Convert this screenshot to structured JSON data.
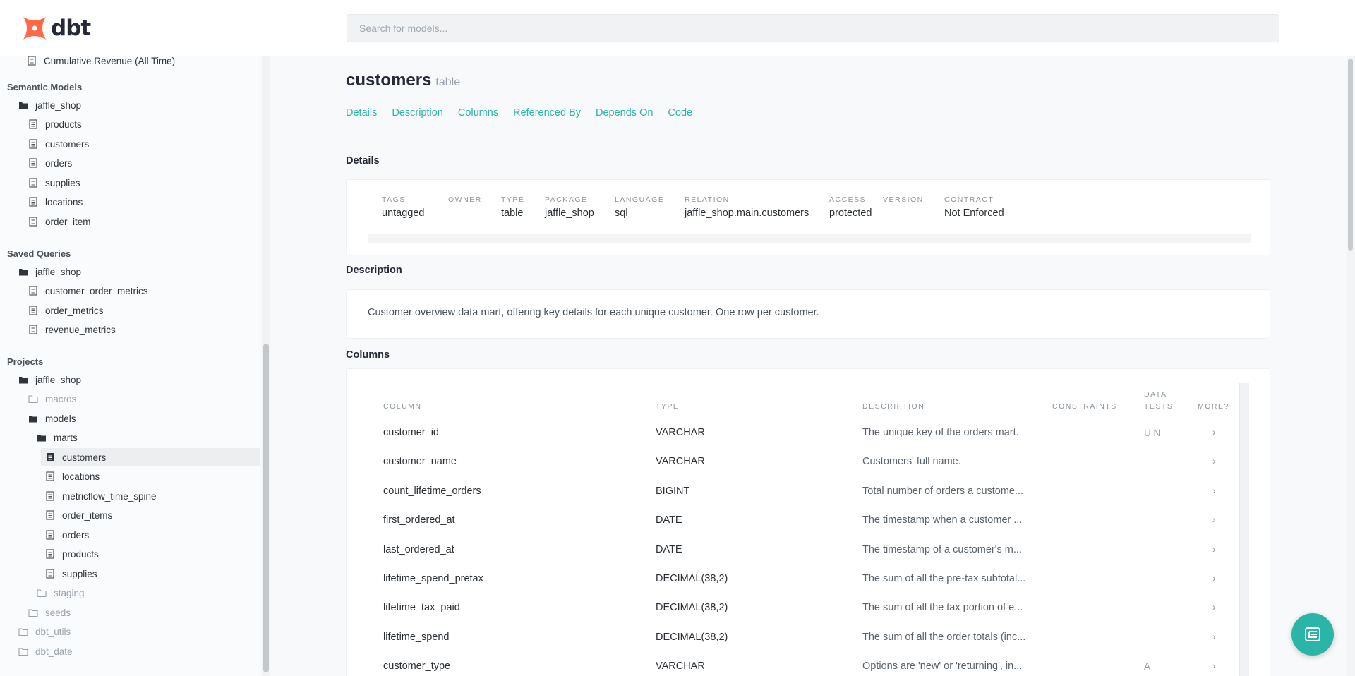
{
  "brand": {
    "name": "dbt",
    "logo_color": "#ff694a"
  },
  "search": {
    "placeholder": "Search for models..."
  },
  "sidebar": {
    "partial_top": "Cumulative Revenue (All Time)",
    "semantic_models": {
      "heading": "Semantic Models",
      "folder": "jaffle_shop",
      "items": [
        "products",
        "customers",
        "orders",
        "supplies",
        "locations",
        "order_item"
      ]
    },
    "saved_queries": {
      "heading": "Saved Queries",
      "folder": "jaffle_shop",
      "items": [
        "customer_order_metrics",
        "order_metrics",
        "revenue_metrics"
      ]
    },
    "projects": {
      "heading": "Projects",
      "folder": "jaffle_shop",
      "macros": "macros",
      "models": "models",
      "marts": "marts",
      "mart_items": [
        "customers",
        "locations",
        "metricflow_time_spine",
        "order_items",
        "orders",
        "products",
        "supplies"
      ],
      "active": "customers",
      "staging": "staging",
      "seeds": "seeds",
      "packages": [
        "dbt_utils",
        "dbt_date"
      ]
    }
  },
  "model": {
    "name": "customers",
    "type": "table"
  },
  "tabs": [
    "Details",
    "Description",
    "Columns",
    "Referenced By",
    "Depends On",
    "Code"
  ],
  "details": {
    "heading": "Details",
    "fields": [
      {
        "label": "Tags",
        "value": "untagged"
      },
      {
        "label": "Owner",
        "value": ""
      },
      {
        "label": "Type",
        "value": "table"
      },
      {
        "label": "Package",
        "value": "jaffle_shop"
      },
      {
        "label": "Language",
        "value": "sql"
      },
      {
        "label": "Relation",
        "value": "jaffle_shop.main.customers"
      },
      {
        "label": "Access",
        "value": "protected"
      },
      {
        "label": "Version",
        "value": ""
      },
      {
        "label": "Contract",
        "value": "Not Enforced"
      }
    ]
  },
  "description": {
    "heading": "Description",
    "text": "Customer overview data mart, offering key details for each unique customer. One row per customer."
  },
  "columns": {
    "heading": "Columns",
    "headers": {
      "column": "Column",
      "type": "Type",
      "description": "Description",
      "constraints": "Constraints",
      "data_tests": "Data Tests",
      "more": "More?"
    },
    "chevron": "›",
    "rows": [
      {
        "name": "customer_id",
        "type": "VARCHAR",
        "description": "The unique key of the orders mart.",
        "tests": "U N"
      },
      {
        "name": "customer_name",
        "type": "VARCHAR",
        "description": "Customers' full name.",
        "tests": ""
      },
      {
        "name": "count_lifetime_orders",
        "type": "BIGINT",
        "description": "Total number of orders a custome...",
        "tests": ""
      },
      {
        "name": "first_ordered_at",
        "type": "DATE",
        "description": "The timestamp when a customer ...",
        "tests": ""
      },
      {
        "name": "last_ordered_at",
        "type": "DATE",
        "description": "The timestamp of a customer's m...",
        "tests": ""
      },
      {
        "name": "lifetime_spend_pretax",
        "type": "DECIMAL(38,2)",
        "description": "The sum of all the pre-tax subtotal...",
        "tests": ""
      },
      {
        "name": "lifetime_tax_paid",
        "type": "DECIMAL(38,2)",
        "description": "The sum of all the tax portion of e...",
        "tests": ""
      },
      {
        "name": "lifetime_spend",
        "type": "DECIMAL(38,2)",
        "description": "The sum of all the order totals (inc...",
        "tests": ""
      },
      {
        "name": "customer_type",
        "type": "VARCHAR",
        "description": "Options are 'new' or 'returning', in...",
        "tests": "A"
      }
    ]
  },
  "accent_color": "#2bb5a8"
}
